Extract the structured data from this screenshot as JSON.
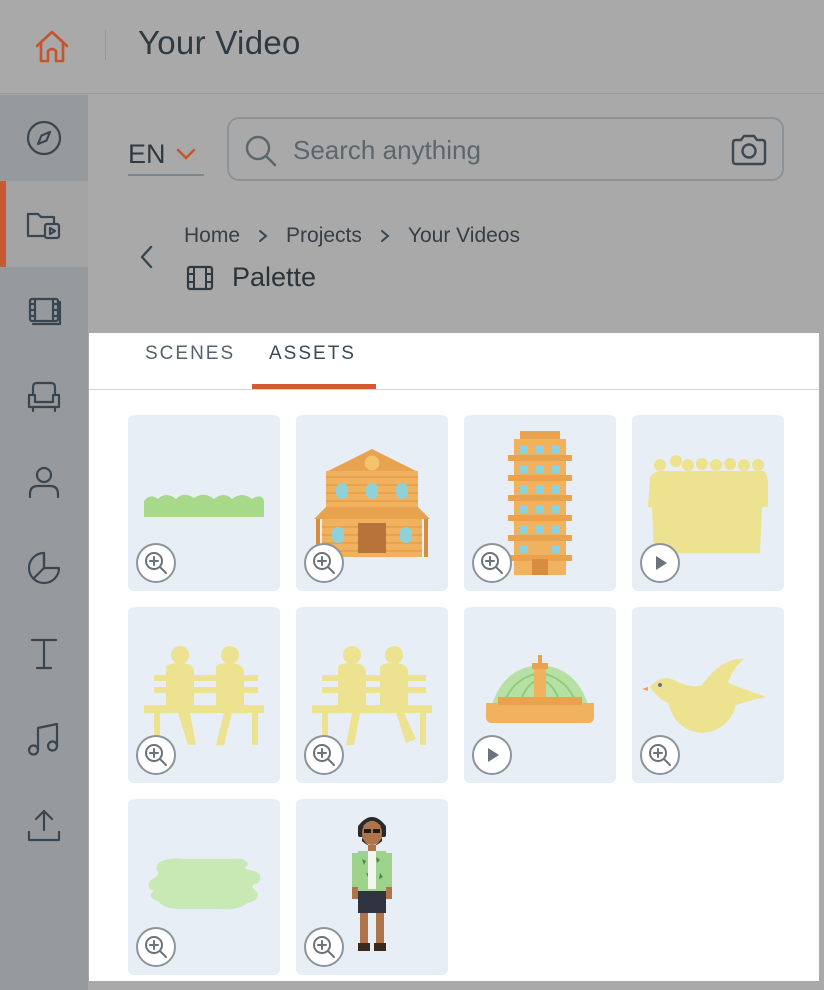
{
  "header": {
    "title": "Your Video",
    "home_icon": "home-icon"
  },
  "rail": {
    "items": [
      {
        "name": "explore",
        "icon": "compass-icon",
        "active": false
      },
      {
        "name": "projects",
        "icon": "folder-video-icon",
        "active": true
      },
      {
        "name": "scenes",
        "icon": "film-strip-icon",
        "active": false
      },
      {
        "name": "props",
        "icon": "armchair-icon",
        "active": false
      },
      {
        "name": "characters",
        "icon": "person-icon",
        "active": false
      },
      {
        "name": "charts",
        "icon": "pie-chart-icon",
        "active": false
      },
      {
        "name": "text",
        "icon": "text-icon",
        "active": false
      },
      {
        "name": "music",
        "icon": "music-note-icon",
        "active": false
      },
      {
        "name": "upload",
        "icon": "upload-icon",
        "active": false
      }
    ]
  },
  "toolbar": {
    "language": "EN",
    "search_placeholder": "Search anything"
  },
  "breadcrumb": {
    "items": [
      "Home",
      "Projects",
      "Your Videos"
    ],
    "title": "Palette"
  },
  "tabs": [
    {
      "label": "SCENES",
      "active": false
    },
    {
      "label": "ASSETS",
      "active": true
    }
  ],
  "assets": [
    {
      "name": "grass-hedge",
      "action": "zoom"
    },
    {
      "name": "bank-building",
      "action": "zoom"
    },
    {
      "name": "tall-tower",
      "action": "zoom"
    },
    {
      "name": "crowd-silhouettes",
      "action": "play"
    },
    {
      "name": "bench-couple",
      "action": "zoom"
    },
    {
      "name": "bench-couple-alt",
      "action": "zoom"
    },
    {
      "name": "fountain",
      "action": "play"
    },
    {
      "name": "bird",
      "action": "zoom"
    },
    {
      "name": "grass-patch",
      "action": "zoom"
    },
    {
      "name": "man-with-headphones",
      "action": "zoom"
    }
  ],
  "colors": {
    "accent": "#d35a30",
    "tile_bg": "#e8eef5",
    "silhouette": "#ede28f",
    "grass": "#a8d98a",
    "building": "#e9a24d"
  }
}
